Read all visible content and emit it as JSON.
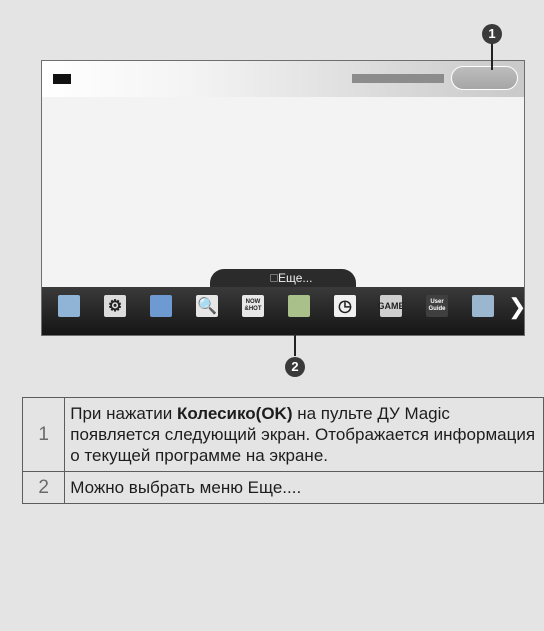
{
  "more_label": "Еще...",
  "callouts": [
    "1",
    "2"
  ],
  "dock_apps": [
    {
      "name": "input-icon",
      "text": "",
      "glyph": "",
      "bg": "#8fb4d6"
    },
    {
      "name": "settings-icon",
      "text": "",
      "glyph": "⚙",
      "bg": "#dcdcdc"
    },
    {
      "name": "internet-globe-icon",
      "text": "",
      "glyph": "",
      "bg": "#6d9ad0"
    },
    {
      "name": "search-icon",
      "text": "",
      "glyph": "🔍",
      "bg": "#e6e6e6"
    },
    {
      "name": "now-and-hot-icon",
      "text": "NOW &HOT",
      "glyph": "",
      "bg": "#e8e8e8"
    },
    {
      "name": "smart-share-icon",
      "text": "",
      "glyph": "",
      "bg": "#a9c08a"
    },
    {
      "name": "clock-icon",
      "text": "",
      "glyph": "◷",
      "bg": "#f0f0f0"
    },
    {
      "name": "game-icon",
      "text": "GAME",
      "glyph": "",
      "bg": "#cfcfcf"
    },
    {
      "name": "user-guide-icon",
      "text": "User Guide",
      "glyph": "",
      "bg": "#3f3f3f"
    },
    {
      "name": "channel-list-icon",
      "text": "",
      "glyph": "",
      "bg": "#9bb6cf"
    }
  ],
  "rows": [
    {
      "num": "1",
      "prefix": "При нажатии ",
      "bold": "Колесико(OK)",
      "suffix": " на пульте ДУ Magic появляется следующий экран. Отображается информация о текущей программе на экране."
    },
    {
      "num": "2",
      "prefix": "Можно выбрать меню Еще....",
      "bold": "",
      "suffix": ""
    }
  ]
}
